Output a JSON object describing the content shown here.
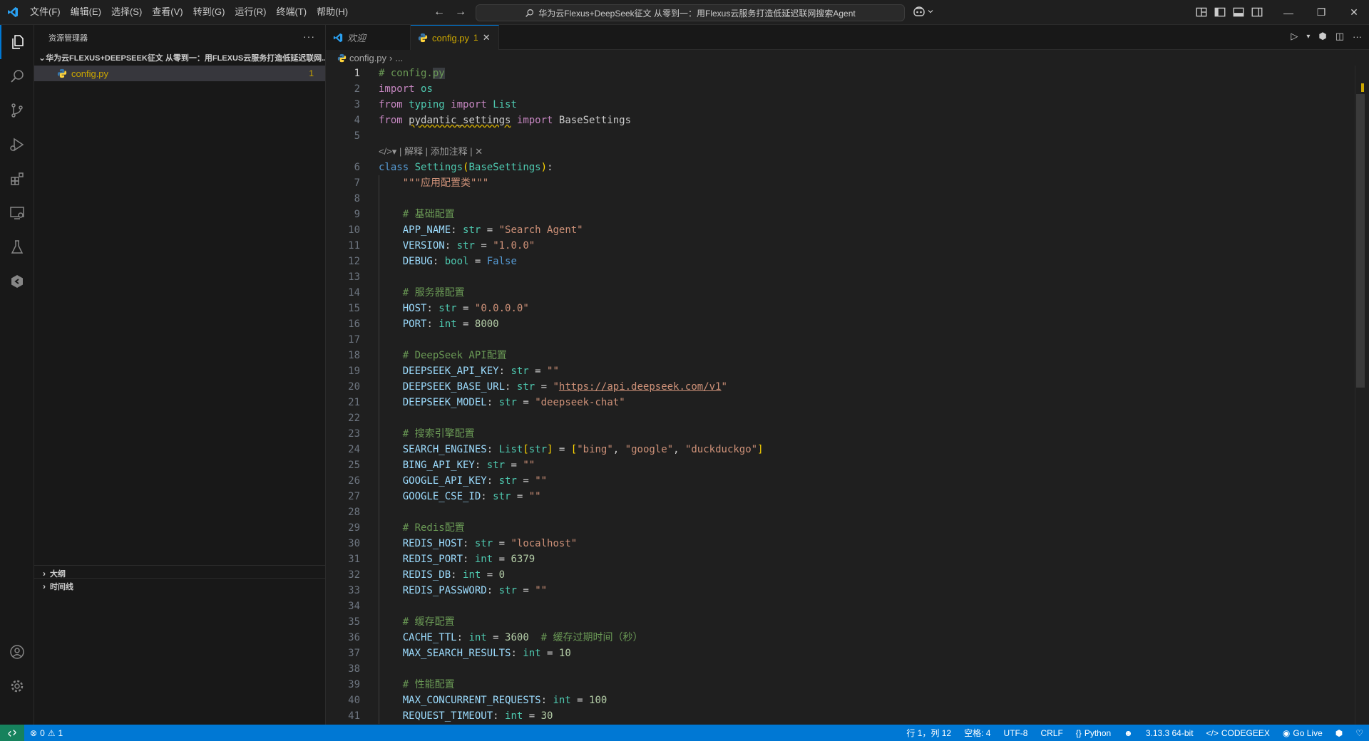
{
  "titlebar": {
    "menus": [
      "文件(F)",
      "编辑(E)",
      "选择(S)",
      "查看(V)",
      "转到(G)",
      "运行(R)",
      "终端(T)",
      "帮助(H)"
    ],
    "search_text": "华为云Flexus+DeepSeek征文 从零到一：用Flexus云服务打造低延迟联网搜索Agent"
  },
  "sidebar": {
    "title": "资源管理器",
    "folder": "华为云FLEXUS+DEEPSEEK征文 从零到一：用FLEXUS云服务打造低延迟联网...",
    "file": {
      "name": "config.py",
      "problems": "1"
    },
    "outline": "大纲",
    "timeline": "时间线"
  },
  "tabs": [
    {
      "label": "欢迎"
    },
    {
      "label": "config.py",
      "badge": "1"
    }
  ],
  "breadcrumb": {
    "file": "config.py",
    "more": "..."
  },
  "codelens": {
    "explain": "解释",
    "comment": "添加注释"
  },
  "code": {
    "l1": "# config.",
    "l1b": "py",
    "l7": "\"\"\"应用配置类\"\"\"",
    "c9": "# 基础配置",
    "s10": "\"Search Agent\"",
    "s11": "\"1.0.0\"",
    "c14": "# 服务器配置",
    "s15": "\"0.0.0.0\"",
    "n16": "8000",
    "c18": "# DeepSeek API配置",
    "s20a": "\"",
    "s20url": "https://api.deepseek.com/v1",
    "s20b": "\"",
    "s21": "\"deepseek-chat\"",
    "c23": "# 搜索引擎配置",
    "s24a": "\"bing\"",
    "s24b": "\"google\"",
    "s24c": "\"duckduckgo\"",
    "c29": "# Redis配置",
    "s30": "\"localhost\"",
    "n31": "6379",
    "n32": "0",
    "c35": "# 缓存配置",
    "n36": "3600",
    "c36": "# 缓存过期时间（秒）",
    "n37": "10",
    "c39": "# 性能配置",
    "n40": "100",
    "n41": "30"
  },
  "statusbar": {
    "errors": "0",
    "warnings": "1",
    "position": "行 1，列 12",
    "spaces": "空格: 4",
    "encoding": "UTF-8",
    "eol": "CRLF",
    "language": "Python",
    "interpreter": "3.13.3 64-bit",
    "codegeex": "CODEGEEX",
    "golive": "Go Live"
  },
  "colors": {
    "accent": "#0078d4",
    "warning": "#cca700",
    "remote": "#16825d"
  }
}
